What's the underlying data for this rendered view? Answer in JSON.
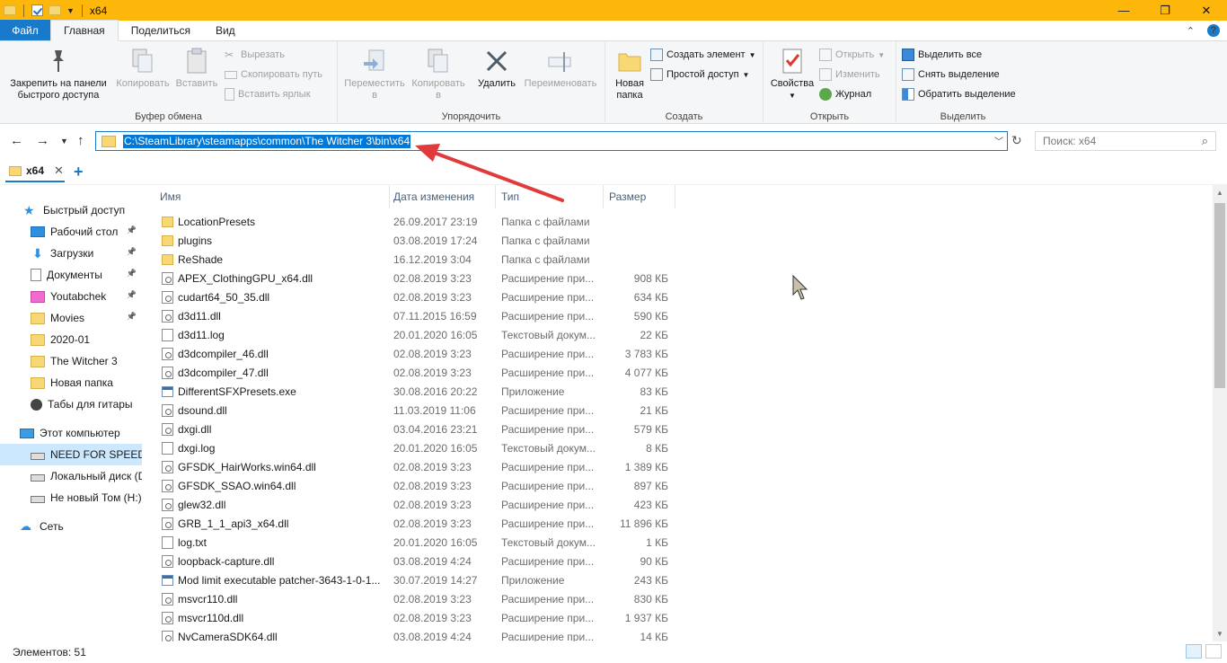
{
  "window": {
    "title": "x64",
    "minimize": "—",
    "maximize": "❐",
    "close": "✕"
  },
  "ribbon_tabs": [
    {
      "label": "Файл"
    },
    {
      "label": "Главная"
    },
    {
      "label": "Поделиться"
    },
    {
      "label": "Вид"
    }
  ],
  "ribbon": {
    "clipboard": {
      "pin_label": "Закрепить на панели быстрого доступа",
      "copy_label": "Копировать",
      "paste_label": "Вставить",
      "cut_label": "Вырезать",
      "copy_path_label": "Скопировать путь",
      "paste_shortcut_label": "Вставить ярлык",
      "group_label": "Буфер обмена"
    },
    "organize": {
      "move_label": "Переместить в",
      "copy_to_label": "Копировать в",
      "delete_label": "Удалить",
      "rename_label": "Переименовать",
      "group_label": "Упорядочить"
    },
    "new": {
      "new_folder_label": "Новая папка",
      "new_item_label": "Создать элемент",
      "easy_access_label": "Простой доступ",
      "group_label": "Создать"
    },
    "open": {
      "properties_label": "Свойства",
      "open_label": "Открыть",
      "edit_label": "Изменить",
      "history_label": "Журнал",
      "group_label": "Открыть"
    },
    "select": {
      "select_all_label": "Выделить все",
      "select_none_label": "Снять выделение",
      "invert_label": "Обратить выделение",
      "group_label": "Выделить"
    }
  },
  "address": {
    "path": "C:\\SteamLibrary\\steamapps\\common\\The Witcher 3\\bin\\x64",
    "search_placeholder": "Поиск: x64"
  },
  "folder_tab": {
    "label": "x64",
    "icon_letter": "c"
  },
  "nav_pane": {
    "quick_access": "Быстрый доступ",
    "items": [
      {
        "label": "Рабочий стол",
        "icon": "desktop-icon",
        "pinned": true
      },
      {
        "label": "Загрузки",
        "icon": "downloads-icon",
        "pinned": true
      },
      {
        "label": "Документы",
        "icon": "documents-icon",
        "pinned": true
      },
      {
        "label": "Youtabchek",
        "icon": "folder-icon",
        "pinned": true
      },
      {
        "label": "Movies",
        "icon": "folder-icon",
        "pinned": true
      },
      {
        "label": "2020-01",
        "icon": "folder-icon",
        "pinned": false
      },
      {
        "label": "The Witcher 3",
        "icon": "folder-icon",
        "pinned": false
      },
      {
        "label": "Новая папка",
        "icon": "folder-icon",
        "pinned": false
      },
      {
        "label": "Табы для гитары",
        "icon": "guitar-icon",
        "pinned": false
      }
    ],
    "this_pc": "Этот компьютер",
    "drives": [
      {
        "label": "NEED FOR SPEED (C",
        "selected": true
      },
      {
        "label": "Локальный диск (D",
        "selected": false
      },
      {
        "label": "Не новый Том (H:)",
        "selected": false
      }
    ],
    "network": "Сеть"
  },
  "columns": {
    "name": "Имя",
    "date": "Дата изменения",
    "type": "Тип",
    "size": "Размер"
  },
  "files": [
    {
      "name": "LocationPresets",
      "date": "26.09.2017 23:19",
      "type": "Папка с файлами",
      "size": "",
      "kind": "folder"
    },
    {
      "name": "plugins",
      "date": "03.08.2019 17:24",
      "type": "Папка с файлами",
      "size": "",
      "kind": "folder"
    },
    {
      "name": "ReShade",
      "date": "16.12.2019 3:04",
      "type": "Папка с файлами",
      "size": "",
      "kind": "folder"
    },
    {
      "name": "APEX_ClothingGPU_x64.dll",
      "date": "02.08.2019 3:23",
      "type": "Расширение при...",
      "size": "908 КБ",
      "kind": "dll"
    },
    {
      "name": "cudart64_50_35.dll",
      "date": "02.08.2019 3:23",
      "type": "Расширение при...",
      "size": "634 КБ",
      "kind": "dll"
    },
    {
      "name": "d3d11.dll",
      "date": "07.11.2015 16:59",
      "type": "Расширение при...",
      "size": "590 КБ",
      "kind": "dll"
    },
    {
      "name": "d3d11.log",
      "date": "20.01.2020 16:05",
      "type": "Текстовый докум...",
      "size": "22 КБ",
      "kind": "doc"
    },
    {
      "name": "d3dcompiler_46.dll",
      "date": "02.08.2019 3:23",
      "type": "Расширение при...",
      "size": "3 783 КБ",
      "kind": "dll"
    },
    {
      "name": "d3dcompiler_47.dll",
      "date": "02.08.2019 3:23",
      "type": "Расширение при...",
      "size": "4 077 КБ",
      "kind": "dll"
    },
    {
      "name": "DifferentSFXPresets.exe",
      "date": "30.08.2016 20:22",
      "type": "Приложение",
      "size": "83 КБ",
      "kind": "exe"
    },
    {
      "name": "dsound.dll",
      "date": "11.03.2019 11:06",
      "type": "Расширение при...",
      "size": "21 КБ",
      "kind": "dll"
    },
    {
      "name": "dxgi.dll",
      "date": "03.04.2016 23:21",
      "type": "Расширение при...",
      "size": "579 КБ",
      "kind": "dll"
    },
    {
      "name": "dxgi.log",
      "date": "20.01.2020 16:05",
      "type": "Текстовый докум...",
      "size": "8 КБ",
      "kind": "doc"
    },
    {
      "name": "GFSDK_HairWorks.win64.dll",
      "date": "02.08.2019 3:23",
      "type": "Расширение при...",
      "size": "1 389 КБ",
      "kind": "dll"
    },
    {
      "name": "GFSDK_SSAO.win64.dll",
      "date": "02.08.2019 3:23",
      "type": "Расширение при...",
      "size": "897 КБ",
      "kind": "dll"
    },
    {
      "name": "glew32.dll",
      "date": "02.08.2019 3:23",
      "type": "Расширение при...",
      "size": "423 КБ",
      "kind": "dll"
    },
    {
      "name": "GRB_1_1_api3_x64.dll",
      "date": "02.08.2019 3:23",
      "type": "Расширение при...",
      "size": "11 896 КБ",
      "kind": "dll"
    },
    {
      "name": "log.txt",
      "date": "20.01.2020 16:05",
      "type": "Текстовый докум...",
      "size": "1 КБ",
      "kind": "doc"
    },
    {
      "name": "loopback-capture.dll",
      "date": "03.08.2019 4:24",
      "type": "Расширение при...",
      "size": "90 КБ",
      "kind": "dll"
    },
    {
      "name": "Mod limit executable patcher-3643-1-0-1...",
      "date": "30.07.2019 14:27",
      "type": "Приложение",
      "size": "243 КБ",
      "kind": "exe"
    },
    {
      "name": "msvcr110.dll",
      "date": "02.08.2019 3:23",
      "type": "Расширение при...",
      "size": "830 КБ",
      "kind": "dll"
    },
    {
      "name": "msvcr110d.dll",
      "date": "02.08.2019 3:23",
      "type": "Расширение при...",
      "size": "1 937 КБ",
      "kind": "dll"
    },
    {
      "name": "NvCameraSDK64.dll",
      "date": "03.08.2019 4:24",
      "type": "Расширение при...",
      "size": "14 КБ",
      "kind": "dll"
    }
  ],
  "status": {
    "items_count": "Элементов: 51"
  },
  "colors": {
    "titlebar": "#fdb60a",
    "accent": "#1979ca",
    "selection": "#0078d7",
    "annotation_arrow": "#e03a3a"
  }
}
